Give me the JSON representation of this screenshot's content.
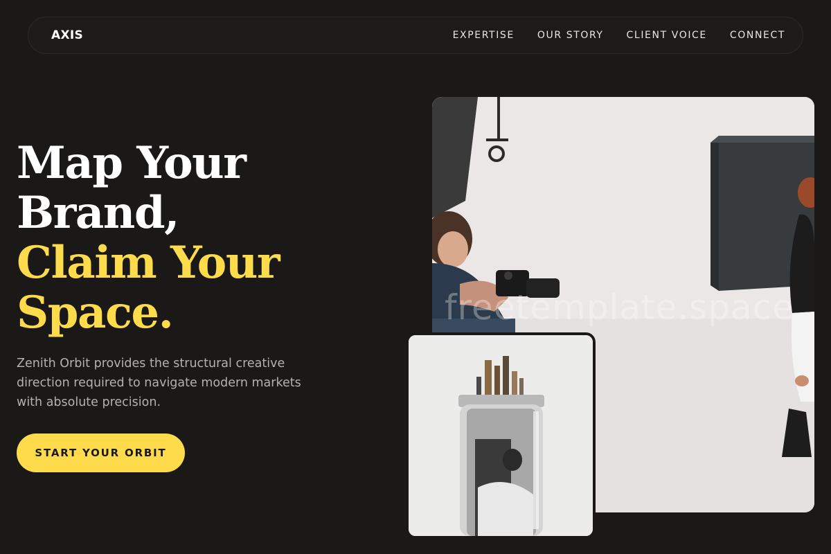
{
  "nav": {
    "brand": "AXIS",
    "links": [
      "EXPERTISE",
      "OUR STORY",
      "CLIENT VOICE",
      "CONNECT"
    ]
  },
  "hero": {
    "title_line1": "Map Your",
    "title_line2": "Brand,",
    "title_line3": "Claim Your",
    "title_line4": "Space.",
    "description": "Zenith Orbit provides the structural creative direction required to navigate modern markets with absolute precision.",
    "cta_label": "START YOUR ORBIT"
  },
  "media": {
    "main_photo_icon": "photographer-studio-photo",
    "main_watermark": "freetemplate.space",
    "inset_photo_icon": "paintbrush-jar-photo"
  },
  "colors": {
    "background": "#1b1918",
    "accent": "#fddb4a",
    "text_primary": "#ffffff",
    "text_muted": "#b5b1ac"
  }
}
